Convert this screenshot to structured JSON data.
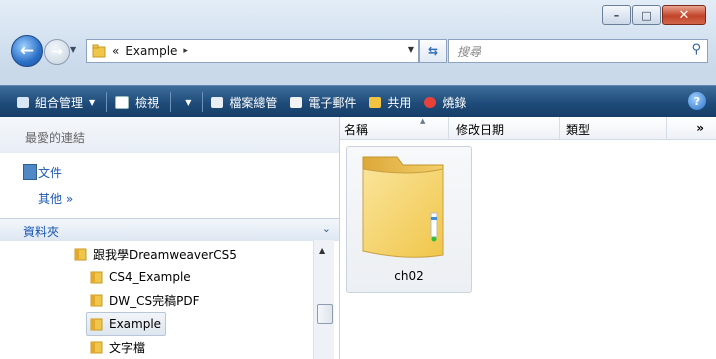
{
  "window": {
    "caption_buttons": [
      {
        "name": "minimize-button",
        "glyph": "–"
      },
      {
        "name": "maximize-button",
        "glyph": "□"
      },
      {
        "name": "close-button",
        "glyph": "✕"
      }
    ]
  },
  "address": {
    "prefix": "«",
    "crumb": "Example",
    "crumb_arrow": "▸"
  },
  "search": {
    "placeholder": "搜尋"
  },
  "toolbar": {
    "organize": "組合管理",
    "views": "檢視",
    "explore": "檔案總管",
    "email": "電子郵件",
    "share": "共用",
    "burn": "燒錄",
    "help": "?"
  },
  "favorites": {
    "title": "最愛的連結",
    "documents": "文件",
    "more": "其他 »"
  },
  "folders": {
    "title": "資料夾",
    "tree": [
      {
        "label": "跟我學DreamweaverCS5"
      },
      {
        "label": "CS4_Example"
      },
      {
        "label": "DW_CS完稿PDF"
      },
      {
        "label": "Example",
        "selected": true
      },
      {
        "label": "文字檔"
      }
    ]
  },
  "columns": {
    "name": "名稱",
    "modified": "修改日期",
    "type": "類型",
    "more": "»"
  },
  "items": [
    {
      "label": "ch02"
    }
  ],
  "colors": {
    "toolbar": "#1e4b79",
    "link": "#1a56b2",
    "folder": "#f0c64a"
  }
}
